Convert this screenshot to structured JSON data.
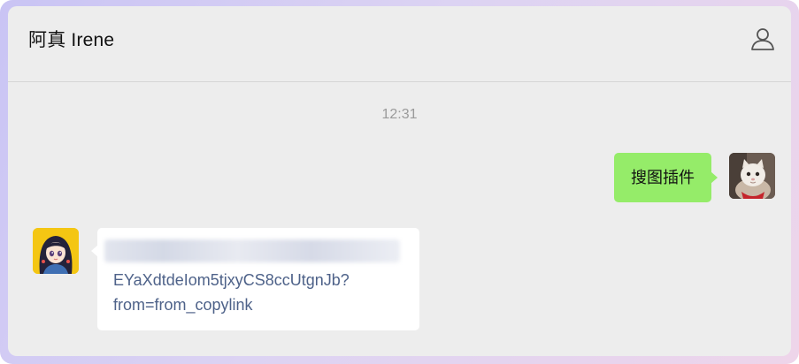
{
  "chat": {
    "title": "阿真 Irene"
  },
  "icons": {
    "profile": "person-outline-icon"
  },
  "messages": [
    {
      "time": "12:31"
    },
    {
      "sender": "self",
      "avatar": "cat-avatar",
      "text": "搜图插件",
      "bubble_color": "#95ec69"
    },
    {
      "sender": "other",
      "avatar": "cartoon-girl-avatar",
      "link_line_1": "EYaXdtdeIom5tjxyCS8ccUtgnJb?",
      "link_line_2": "from=from_copylink",
      "link_color": "#4e6289"
    }
  ],
  "colors": {
    "window_bg": "#ededed",
    "header_divider": "#d6d6d6",
    "timestamp": "#9a9a9a"
  }
}
